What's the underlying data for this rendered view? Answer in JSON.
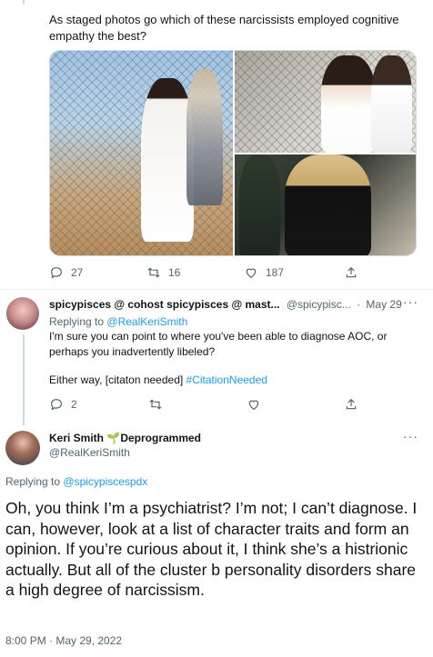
{
  "tweet1": {
    "text": "As staged photos go which of these narcissists employed cognitive empathy the best?",
    "actions": {
      "replies": "27",
      "retweets": "16",
      "likes": "187"
    }
  },
  "tweet2": {
    "display_name": "spicypisces @ cohost spicypisces @ mast...",
    "handle": "@spicypisc...",
    "separator": "·",
    "date": "May 29",
    "replying_to_label": "Replying to",
    "replying_to_handle": "@RealKeriSmith",
    "body": "I'm sure you can point to where you've been able to diagnose AOC, or perhaps you inadvertently libeled?",
    "footer_text": "Either way, [citaton needed]",
    "hashtag": "#CitationNeeded",
    "actions": {
      "replies": "2",
      "retweets": "",
      "likes": ""
    }
  },
  "tweet3": {
    "display_name": "Keri Smith",
    "badge_emoji": "🌱",
    "badge_text": "Deprogrammed",
    "handle": "@RealKeriSmith",
    "replying_to_label": "Replying to",
    "replying_to_handle": "@spicypiscespdx",
    "body": "Oh, you think I’m a psychiatrist? I’m not; I can’t diagnose. I can, however, look at a list of character traits and form an opinion. If you’re curious about it, I think she’s a histrionic actually. But all of the cluster b personality disorders share a high degree of narcissism.",
    "timestamp": "8:00 PM · May 29, 2022"
  },
  "icons": {
    "reply": "reply-icon",
    "retweet": "retweet-icon",
    "like": "heart-icon",
    "share": "share-icon",
    "more": "more-icon"
  },
  "colors": {
    "link": "#1d9bf0",
    "muted": "#536471",
    "text": "#0f1419",
    "thread": "#cfd9de"
  }
}
